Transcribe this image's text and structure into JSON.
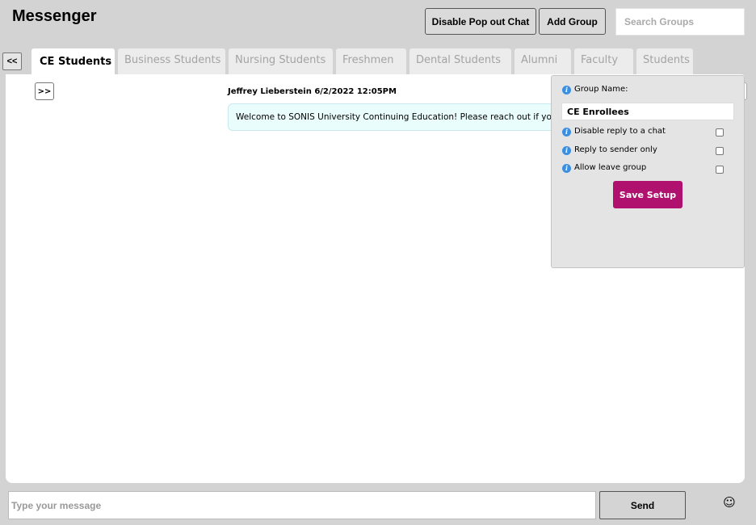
{
  "app": {
    "title": "Messenger"
  },
  "header": {
    "popout_label": "Disable Pop out Chat",
    "add_group_label": "Add Group",
    "search_placeholder": "Search Groups"
  },
  "nav": {
    "collapse_label": "<<",
    "expand_label": ">>"
  },
  "tabs": [
    {
      "label": "CE Students",
      "active": true
    },
    {
      "label": "Business Students",
      "active": false
    },
    {
      "label": "Nursing Students",
      "active": false
    },
    {
      "label": "Freshmen",
      "active": false
    },
    {
      "label": "Dental Students",
      "active": false
    },
    {
      "label": "Alumni",
      "active": false
    },
    {
      "label": "Faculty",
      "active": false
    },
    {
      "label": "Students",
      "active": false
    }
  ],
  "messages": [
    {
      "meta": "Jeffrey Lieberstein 6/2/2022 12:05PM",
      "text": "Welcome to SONIS University Continuing Education! Please reach out if you ha"
    }
  ],
  "setup": {
    "group_name_label": "Group Name:",
    "group_name_value": "CE Enrollees",
    "options": [
      {
        "label": "Disable reply to a chat",
        "checked": false
      },
      {
        "label": "Reply to sender only",
        "checked": false
      },
      {
        "label": "Allow leave group",
        "checked": false
      }
    ],
    "save_label": "Save Setup"
  },
  "composer": {
    "placeholder": "Type your message",
    "send_label": "Send",
    "emoji_icon": "smiley-icon"
  },
  "colors": {
    "background": "#d3d3d3",
    "accent": "#b0106e",
    "info": "#3b8fe0",
    "bubble": "#eafdfd"
  }
}
